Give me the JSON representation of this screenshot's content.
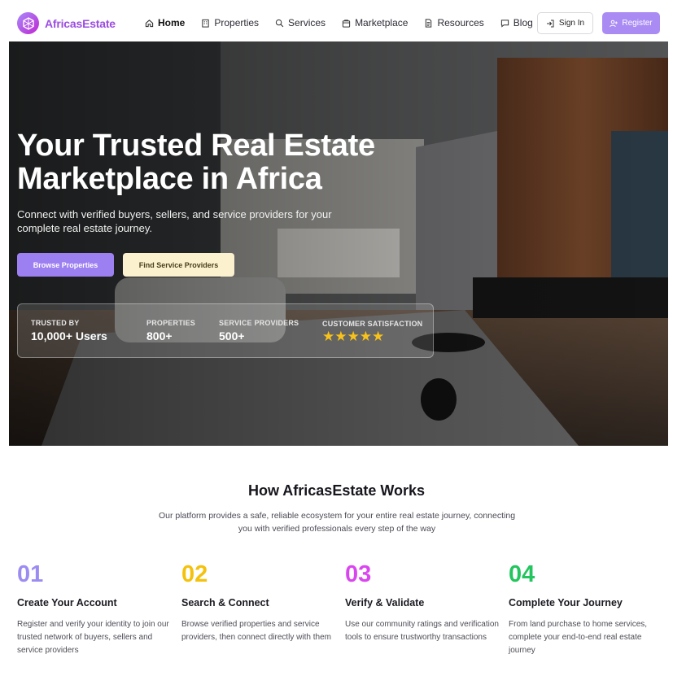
{
  "header": {
    "brand": "AfricasEstate",
    "nav": [
      {
        "label": "Home",
        "icon": "home-icon",
        "active": true
      },
      {
        "label": "Properties",
        "icon": "building-icon"
      },
      {
        "label": "Services",
        "icon": "search-icon"
      },
      {
        "label": "Marketplace",
        "icon": "store-icon"
      },
      {
        "label": "Resources",
        "icon": "document-icon"
      },
      {
        "label": "Blog",
        "icon": "chat-icon"
      }
    ],
    "signin_label": "Sign In",
    "register_label": "Register"
  },
  "hero": {
    "title_line1": "Your Trusted Real Estate",
    "title_line2": "Marketplace in Africa",
    "subtitle": "Connect with verified buyers, sellers, and service providers for your complete real estate journey.",
    "browse_label": "Browse Properties",
    "find_label": "Find Service Providers",
    "stats": [
      {
        "label": "Trusted by",
        "value": "10,000+ Users"
      },
      {
        "label": "Properties",
        "value": "800+"
      },
      {
        "label": "Service Providers",
        "value": "500+"
      },
      {
        "label": "Customer Satisfaction",
        "stars": 5
      }
    ]
  },
  "how": {
    "title": "How AfricasEstate Works",
    "subtitle": "Our platform provides a safe, reliable ecosystem for your entire real estate journey, connecting you with verified professionals every step of the way",
    "steps": [
      {
        "num": "01",
        "color": "#9b8cf2",
        "title": "Create Your Account",
        "desc": "Register and verify your identity to join our trusted network of buyers, sellers and service providers"
      },
      {
        "num": "02",
        "color": "#f4c20d",
        "title": "Search & Connect",
        "desc": "Browse verified properties and service providers, then connect directly with them"
      },
      {
        "num": "03",
        "color": "#d946ef",
        "title": "Verify & Validate",
        "desc": "Use our community ratings and verification tools to ensure trustworthy transactions"
      },
      {
        "num": "04",
        "color": "#22c55e",
        "title": "Complete Your Journey",
        "desc": "From land purchase to home services, complete your end-to-end real estate journey"
      }
    ]
  },
  "colors": {
    "brand": "#9b4de0",
    "accent": "#a98bf3",
    "star": "#f8c21a"
  }
}
